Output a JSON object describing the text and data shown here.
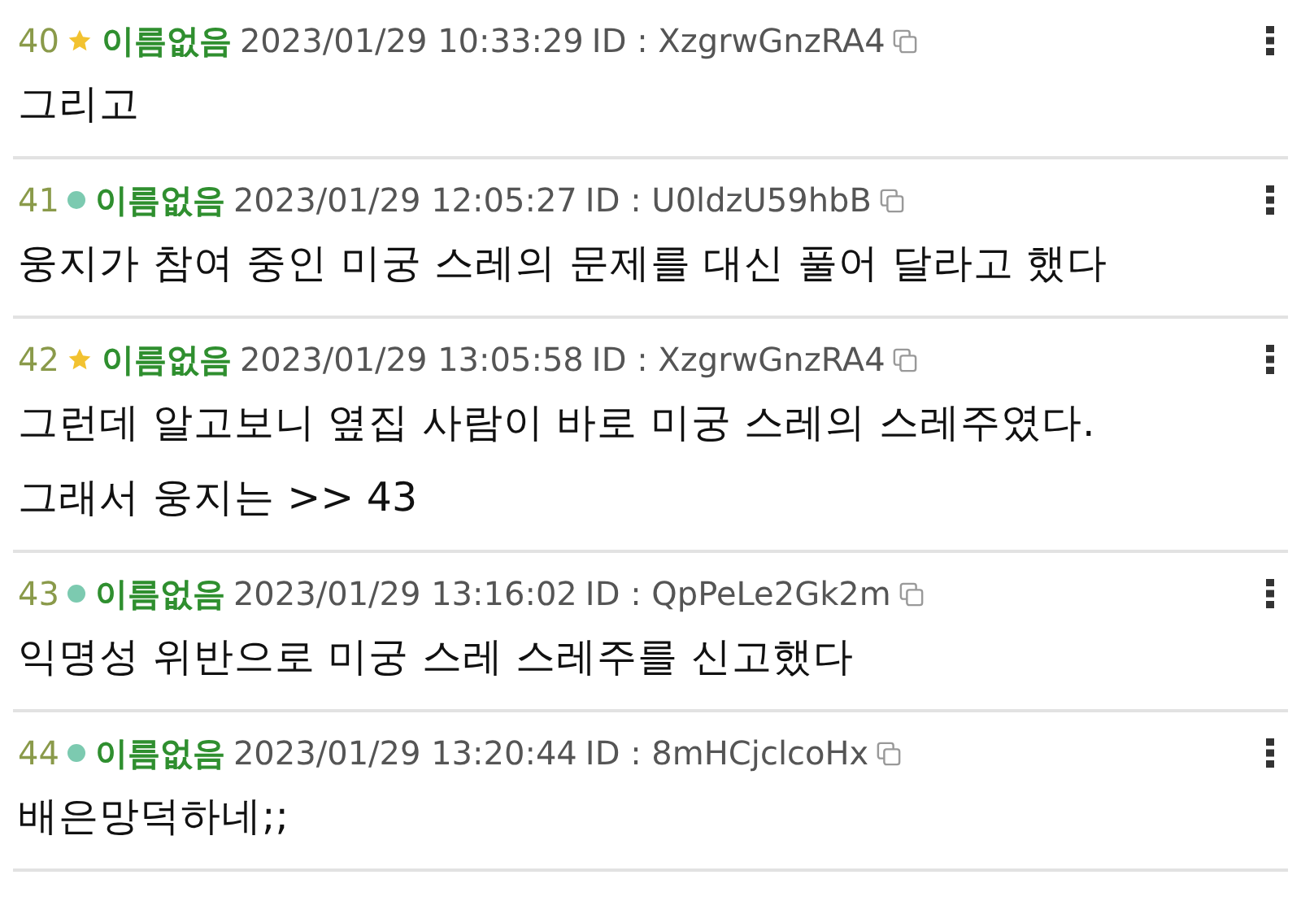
{
  "posts": [
    {
      "number": "40",
      "kind": "star",
      "author": "이름없음",
      "datetime": "2023/01/29 10:33:29",
      "id_label": "ID : XzgrwGnzRA4",
      "body": [
        "그리고"
      ]
    },
    {
      "number": "41",
      "kind": "dot",
      "author": "이름없음",
      "datetime": "2023/01/29 12:05:27",
      "id_label": "ID : U0ldzU59hbB",
      "body": [
        "웅지가 참여 중인 미궁 스레의 문제를 대신 풀어 달라고 했다"
      ]
    },
    {
      "number": "42",
      "kind": "star",
      "author": "이름없음",
      "datetime": "2023/01/29 13:05:58",
      "id_label": "ID : XzgrwGnzRA4",
      "body": [
        "그런데 알고보니 옆집 사람이 바로 미궁 스레의 스레주였다.",
        "그래서 웅지는 >> 43"
      ]
    },
    {
      "number": "43",
      "kind": "dot",
      "author": "이름없음",
      "datetime": "2023/01/29 13:16:02",
      "id_label": "ID : QpPeLe2Gk2m",
      "body": [
        "익명성 위반으로 미궁 스레 스레주를 신고했다"
      ]
    },
    {
      "number": "44",
      "kind": "dot",
      "author": "이름없음",
      "datetime": "2023/01/29 13:20:44",
      "id_label": "ID : 8mHCjclcoHx",
      "body": [
        "배은망덕하네;;"
      ]
    }
  ]
}
